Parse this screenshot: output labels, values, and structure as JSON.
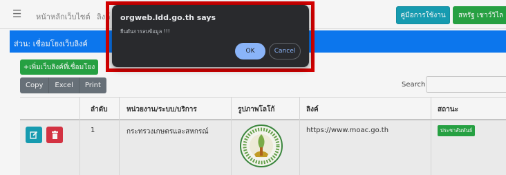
{
  "navbar": {
    "menu_icon": "hamburger-icon",
    "home_label": "หน้าหลักเว็บไซต์",
    "truncated_label": "ลิงค์",
    "manual_button": "คู่มือการใช้งาน",
    "user_button": "สหรัฐ เชาว์วิไล",
    "user_dropdown_icon": "chevron-down-icon"
  },
  "section": {
    "title": "ส่วน: เชื่อมโยงเว็บลิงค์"
  },
  "toolbar": {
    "add_label": "+เพิ่มเว็บลิงค์ที่เชื่อมโยง",
    "export_buttons": [
      "Copy",
      "Excel",
      "Print"
    ],
    "search_label": "Search:",
    "search_value": ""
  },
  "table": {
    "columns": [
      "",
      "ลำดับ",
      "หน่วยงาน/ระบบ/บริการ",
      "รูปภาพโลโก้",
      "ลิงค์",
      "สถานะ"
    ],
    "rows": [
      {
        "edit_icon": "edit-icon",
        "delete_icon": "trash-icon",
        "order": "1",
        "agency": "กระทรวงเกษตรและสหกรณ์",
        "logo": "ministry-seal-logo",
        "link": "https://www.moac.go.th",
        "status": "ประชาสัมพันธ์"
      }
    ]
  },
  "dialog": {
    "title": "orgweb.ldd.go.th says",
    "message": "ยืนยันการลบข้อมูล !!!",
    "ok_label": "OK",
    "cancel_label": "Cancel"
  },
  "colors": {
    "section_header": "#0d7bf7",
    "success": "#28a745",
    "info": "#17a2b8",
    "danger": "#dc3545",
    "dialog_bg": "#292a2d",
    "dialog_accent": "#8ab4f8",
    "highlight_frame": "#d40000"
  }
}
